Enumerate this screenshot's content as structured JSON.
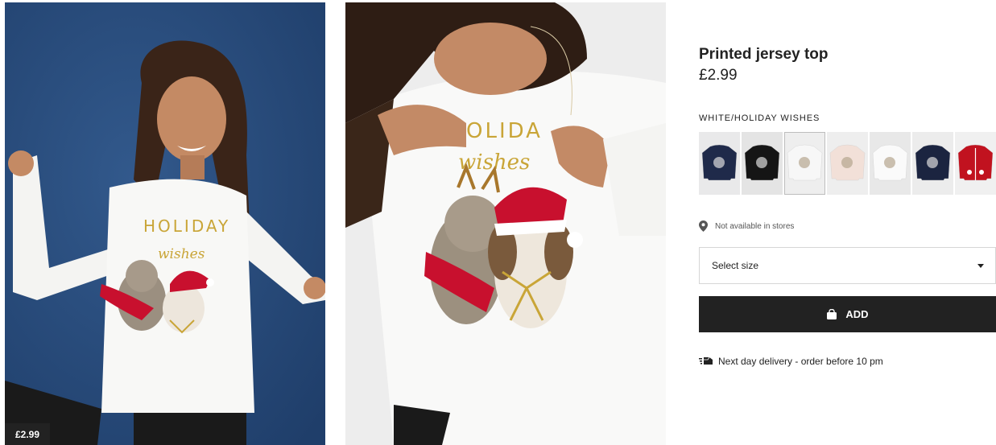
{
  "images": [
    {
      "name": "product-model-photo"
    },
    {
      "name": "product-closeup-photo"
    }
  ],
  "price_badge": "£2.99",
  "product": {
    "title": "Printed jersey top",
    "price": "£2.99",
    "color_name": "WHITE/HOLIDAY WISHES"
  },
  "swatches": [
    {
      "label": "navy-print",
      "bg": "#e9e9ea",
      "shirt": "#1f2a4a",
      "selected": false
    },
    {
      "label": "black-skeleton",
      "bg": "#e4e4e4",
      "shirt": "#151515",
      "selected": false
    },
    {
      "label": "white-print",
      "bg": "#eeeeee",
      "shirt": "#f7f7f7",
      "selected": true
    },
    {
      "label": "light-pink-print",
      "bg": "#eeeeee",
      "shirt": "#f2e0d8",
      "selected": false
    },
    {
      "label": "white-animals",
      "bg": "#e8e8e8",
      "shirt": "#fafafa",
      "selected": false
    },
    {
      "label": "dark-navy-print",
      "bg": "#ececec",
      "shirt": "#1b2440",
      "selected": false
    },
    {
      "label": "red-cardigan",
      "bg": "#f0f0f0",
      "shirt": "#c1121f",
      "selected": false
    }
  ],
  "availability": {
    "icon": "location-pin-icon",
    "text": "Not available in stores"
  },
  "size_select": {
    "label": "Select size",
    "icon": "chevron-down-icon"
  },
  "add_button": {
    "label": "ADD",
    "icon": "shopping-bag-icon"
  },
  "delivery": {
    "icon": "delivery-truck-icon",
    "text": "Next day delivery - order before 10 pm"
  },
  "colors": {
    "dark": "#222222",
    "border": "#d6d6d6",
    "image1_backdrop": "#2a4f80",
    "image2_backdrop": "#ededed"
  }
}
